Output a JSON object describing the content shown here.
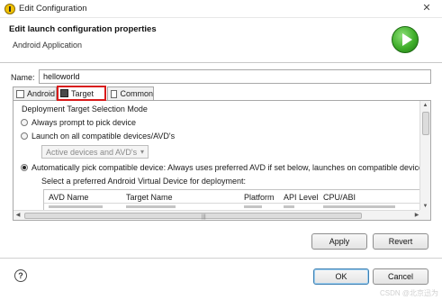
{
  "window": {
    "title": "Edit Configuration",
    "close_glyph": "✕"
  },
  "header": {
    "title": "Edit launch configuration properties",
    "subtitle": "Android Application",
    "icon": "run-icon"
  },
  "name_field": {
    "label": "Name:",
    "value": "helloworld"
  },
  "tabs": [
    {
      "label": "Android",
      "icon": "android-icon",
      "selected": false
    },
    {
      "label": "Target",
      "icon": "target-icon",
      "selected": true
    },
    {
      "label": "Common",
      "icon": "common-icon",
      "selected": false
    }
  ],
  "target_panel": {
    "section_label": "Deployment Target Selection Mode",
    "options": {
      "prompt": "Always prompt to pick device",
      "launch_all": "Launch on all compatible devices/AVD's",
      "auto_pick": "Automatically pick compatible device: Always uses preferred AVD if set below, launches on compatible device"
    },
    "selected_option": "auto_pick",
    "avd_select": {
      "value": "Active devices and AVD's",
      "enabled": false
    },
    "avd_table": {
      "label": "Select a preferred Android Virtual Device for deployment:",
      "columns": [
        "AVD Name",
        "Target Name",
        "Platform",
        "API Level",
        "CPU/ABI"
      ]
    }
  },
  "buttons": {
    "apply": "Apply",
    "revert": "Revert",
    "ok": "OK",
    "cancel": "Cancel",
    "help": "?"
  },
  "watermark": "CSDN @北京迅为"
}
